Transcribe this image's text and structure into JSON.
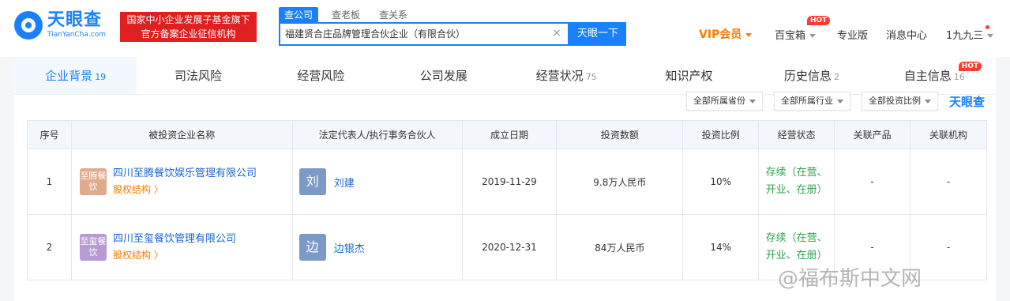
{
  "header": {
    "logo_cn": "天眼查",
    "logo_en": "TianYanCha.com",
    "banner_line1": "国家中小企业发展子基金旗下",
    "banner_line2": "官方备案企业征信机构",
    "search_tabs": [
      "查公司",
      "查老板",
      "查关系"
    ],
    "search_value": "福建贤合庄品牌管理合伙企业（有限合伙）",
    "search_clear": "×",
    "search_button": "天眼一下",
    "nav": {
      "vip": "VIP会员",
      "baibaoxiang": "百宝箱",
      "hot": "HOT",
      "pro": "专业版",
      "messages": "消息中心",
      "user": "1九九三"
    }
  },
  "tabs": [
    {
      "label": "企业背景",
      "count": "19"
    },
    {
      "label": "司法风险",
      "count": ""
    },
    {
      "label": "经营风险",
      "count": ""
    },
    {
      "label": "公司发展",
      "count": ""
    },
    {
      "label": "经营状况",
      "count": "75"
    },
    {
      "label": "知识产权",
      "count": ""
    },
    {
      "label": "历史信息",
      "count": "2"
    },
    {
      "label": "自主信息",
      "count": "16"
    }
  ],
  "filters": {
    "province": "全部所属省份",
    "industry": "全部所属行业",
    "ratio": "全部投资比例",
    "brand": "天眼查"
  },
  "table": {
    "headers": [
      "序号",
      "被投资企业名称",
      "法定代表人/执行事务合伙人",
      "成立日期",
      "投资数额",
      "投资比例",
      "经营状态",
      "关联产品",
      "关联机构"
    ],
    "rows": [
      {
        "index": "1",
        "logo_text": "至腾餐饮",
        "logo_color": "#e0ab8c",
        "company": "四川至腾餐饮娱乐管理有限公司",
        "equity_link": "股权结构 〉",
        "rep_avatar": "刘",
        "rep_name": "刘建",
        "date": "2019-11-29",
        "amount": "9.8万人民币",
        "ratio": "10%",
        "status": "存续（在营、开业、在册）",
        "product": "-",
        "org": "-"
      },
      {
        "index": "2",
        "logo_text": "至玺餐饮",
        "logo_color": "#b79ad6",
        "company": "四川至玺餐饮管理有限公司",
        "equity_link": "股权结构 〉",
        "rep_avatar": "边",
        "rep_name": "边银杰",
        "date": "2020-12-31",
        "amount": "84万人民币",
        "ratio": "14%",
        "status": "存续（在营、开业、在册）",
        "product": "-",
        "org": "-"
      }
    ]
  },
  "watermark": "@福布斯中文网"
}
